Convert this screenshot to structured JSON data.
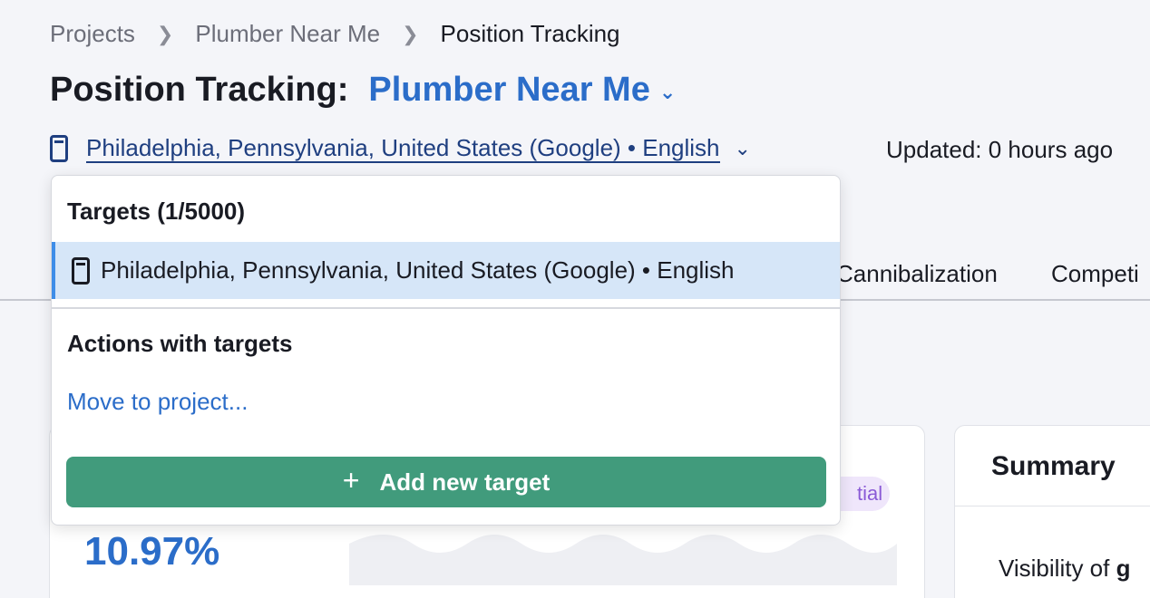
{
  "breadcrumb": {
    "items": [
      "Projects",
      "Plumber Near Me",
      "Position Tracking"
    ],
    "separator": ">"
  },
  "page_title": {
    "label": "Position Tracking:",
    "project": "Plumber Near Me",
    "chevron": "⌄"
  },
  "target": {
    "device_icon": "mobile-phone-icon",
    "label": "Philadelphia, Pennsylvania, United States (Google) • English",
    "chevron": "⌄"
  },
  "updated": "Updated: 0 hours ago",
  "tabs": [
    "Cannibalization",
    "Competi"
  ],
  "dropdown": {
    "targets_heading": "Targets (1/5000)",
    "items": [
      {
        "device_icon": "mobile-phone-icon",
        "label": "Philadelphia, Pennsylvania, United States (Google) • English",
        "selected": true
      }
    ],
    "actions_heading": "Actions with targets",
    "move_link": "Move to project...",
    "add_button": {
      "icon": "+",
      "label": "Add new target"
    }
  },
  "cards": {
    "visibility_value": "10.97%",
    "badge_text": "tial",
    "summary_title": "Summary",
    "summary_text_prefix": "Visibility of ",
    "summary_text_bold": "g"
  },
  "colors": {
    "accent_blue": "#2b6dc9",
    "link_dark_blue": "#1f3f80",
    "selected_bg": "#d6e6f8",
    "selected_border": "#3e8de8",
    "button_green": "#419b7c",
    "badge_bg": "#efe6fb",
    "badge_text": "#8a5ad6"
  }
}
